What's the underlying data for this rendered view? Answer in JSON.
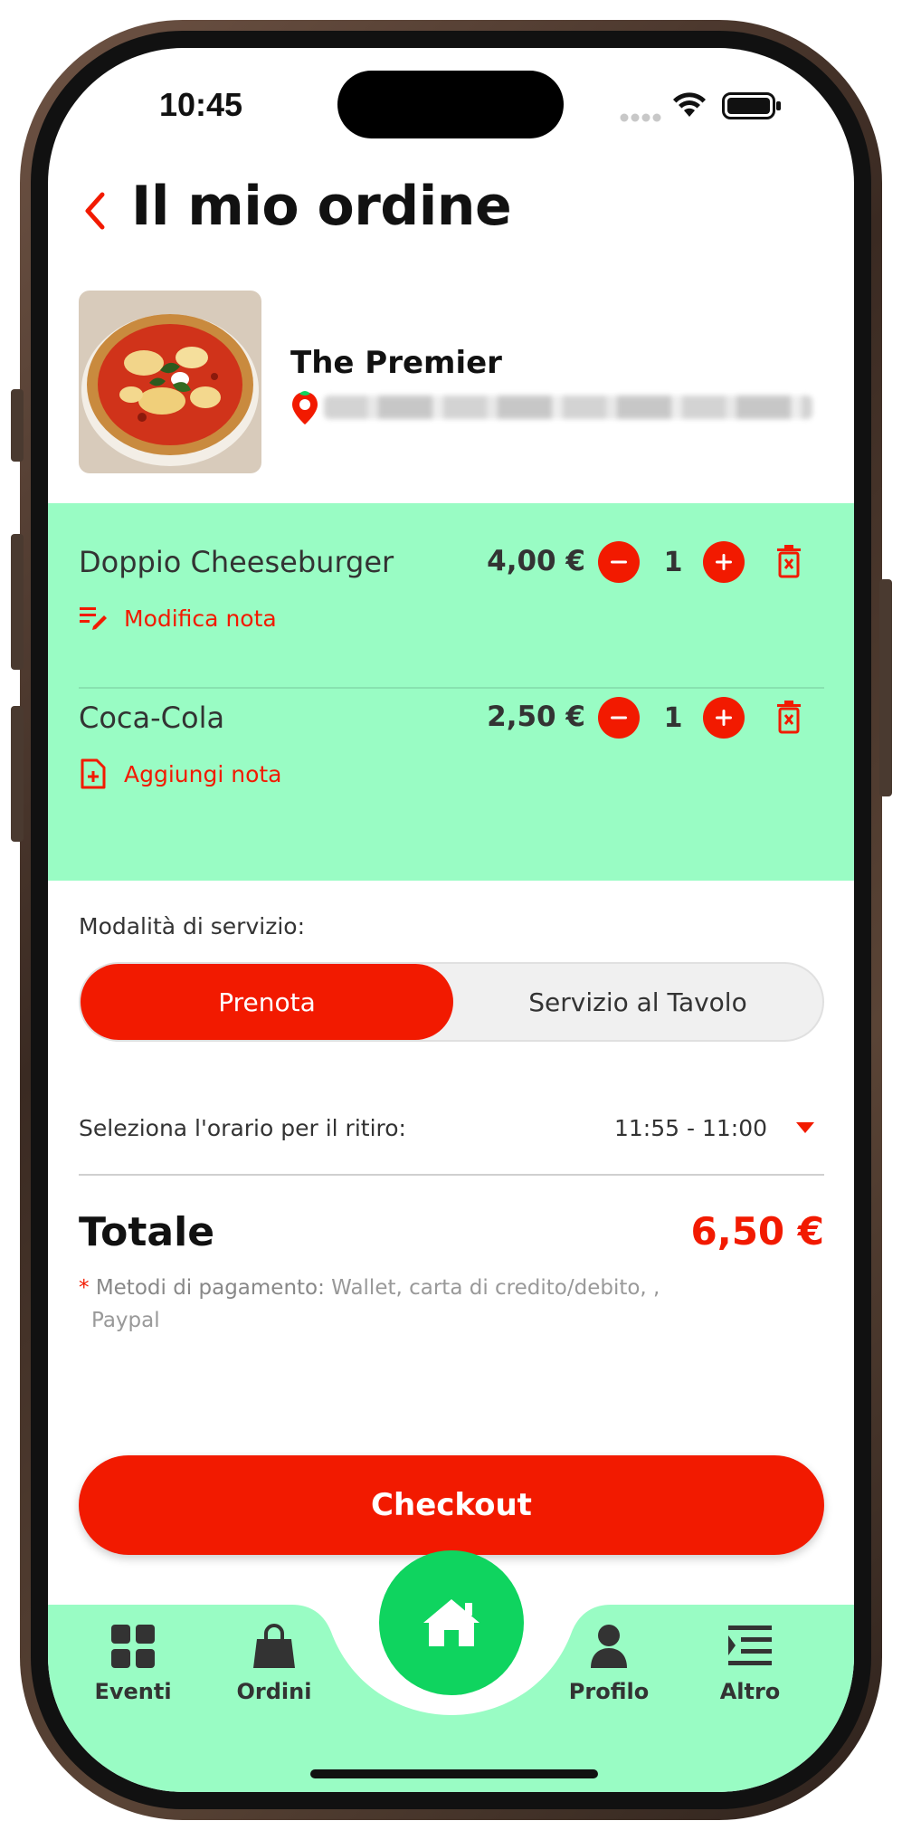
{
  "status_bar": {
    "time": "10:45"
  },
  "header": {
    "title": "Il mio ordine"
  },
  "restaurant": {
    "name": "The Premier"
  },
  "cart": {
    "items": [
      {
        "name": "Doppio Cheeseburger",
        "price": "4,00 €",
        "qty": "1",
        "note_action": "Modifica nota"
      },
      {
        "name": "Coca-Cola",
        "price": "2,50 €",
        "qty": "1",
        "note_action": "Aggiungi nota"
      }
    ]
  },
  "service": {
    "label": "Modalità di servizio:",
    "options": [
      "Prenota",
      "Servizio al Tavolo"
    ],
    "selected": "Prenota"
  },
  "pickup": {
    "label": "Seleziona l'orario per il ritiro:",
    "value": "11:55 - 11:00"
  },
  "total": {
    "label": "Totale",
    "value": "6,50 €",
    "payment_star": "*",
    "payment_key": "Metodi di pagamento:",
    "payment_value_line1": "Wallet, carta di credito/debito, ,",
    "payment_value_line2": "Paypal"
  },
  "checkout": {
    "label": "Checkout"
  },
  "bottom_nav": {
    "items": [
      {
        "label": "Eventi",
        "icon": "grid-icon"
      },
      {
        "label": "Ordini",
        "icon": "shopping-bag-icon"
      },
      {
        "label": "Home",
        "icon": "home-icon"
      },
      {
        "label": "Profilo",
        "icon": "person-icon"
      },
      {
        "label": "Altro",
        "icon": "menu-list-icon"
      }
    ]
  },
  "colors": {
    "accent": "#f21a00",
    "mint": "#99fcc4",
    "home_green": "#0fd45f"
  }
}
